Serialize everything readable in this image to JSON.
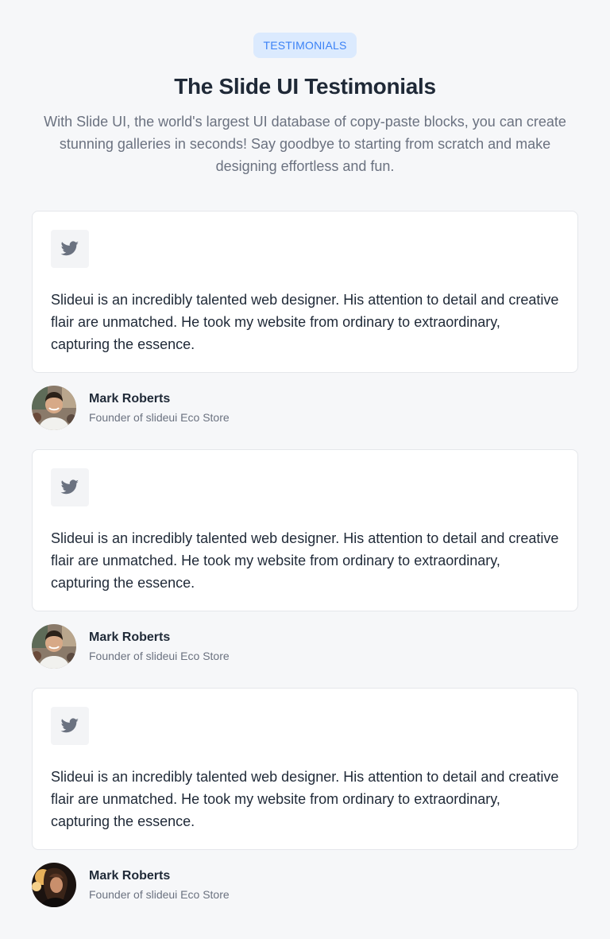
{
  "header": {
    "badge": "TESTIMONIALS",
    "title": "The Slide UI Testimonials",
    "subtitle": "With Slide UI, the world's largest UI database of copy-paste blocks, you can create stunning galleries in seconds! Say goodbye to starting from scratch and make designing effortless and fun."
  },
  "testimonials": [
    {
      "icon": "twitter-icon",
      "quote": "Slideui is an incredibly talented web designer. His attention to detail and creative flair are unmatched. He took my website from ordinary to extraordinary, capturing the essence.",
      "name": "Mark Roberts",
      "role": "Founder of slideui Eco Store"
    },
    {
      "icon": "twitter-icon",
      "quote": "Slideui is an incredibly talented web designer. His attention to detail and creative flair are unmatched. He took my website from ordinary to extraordinary, capturing the essence.",
      "name": "Mark Roberts",
      "role": "Founder of slideui Eco Store"
    },
    {
      "icon": "twitter-icon",
      "quote": "Slideui is an incredibly talented web designer. His attention to detail and creative flair are unmatched. He took my website from ordinary to extraordinary, capturing the essence.",
      "name": "Mark Roberts",
      "role": "Founder of slideui Eco Store"
    }
  ],
  "colors": {
    "accent": "#3b82f6",
    "badge_bg": "#dbeafe",
    "page_bg": "#f6f7f9",
    "icon": "#6b7280"
  }
}
